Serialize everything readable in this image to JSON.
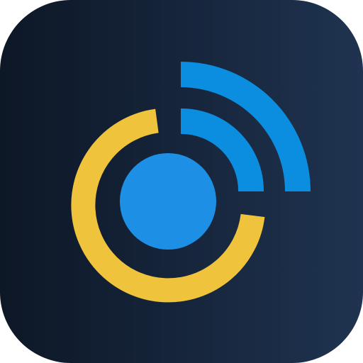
{
  "icon": {
    "subject": "signal-broadcast-icon",
    "colors": {
      "background_start": "#0d1726",
      "background_end": "#1f3350",
      "ring": "#f0c33c",
      "signal": "#0b8de0",
      "dot": "#1d90e6"
    }
  }
}
